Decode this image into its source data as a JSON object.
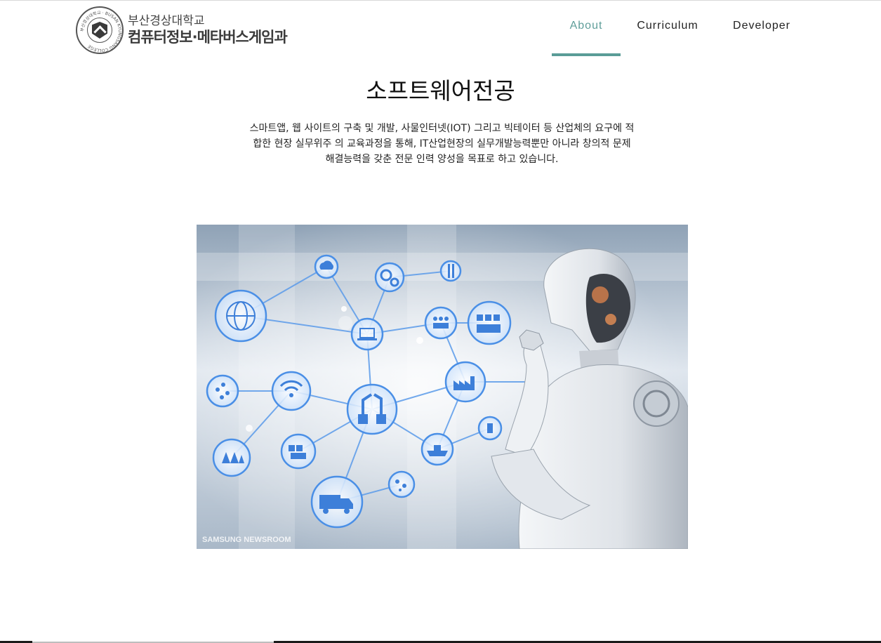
{
  "header": {
    "logo": {
      "university": "부산경상대학교",
      "department": "컴퓨터정보·메타버스게임과",
      "seal_text": "부산경상대학교 · BUSAN KYUNGSANG COLLEGE"
    },
    "nav": [
      {
        "label": "About",
        "active": true
      },
      {
        "label": "Curriculum",
        "active": false
      },
      {
        "label": "Developer",
        "active": false
      }
    ],
    "accent_color": "#5a9c97"
  },
  "main": {
    "title": "소프트웨어전공",
    "description_lines": [
      "스마트앱, 웹 사이트의 구축 및 개발, 사물인터넷(IOT) 그리고 빅테이터 등 산업체의 요구에 적",
      "합한 현장 실무위주 의 교육과정을 통해, IT산업현장의 실무개발능력뿐만 아니라 창의적 문제",
      "해결능력을 갖춘 전문 인력 양성을 목표로 하고 있습니다."
    ],
    "hero_image": {
      "subject": "humanoid robot thinking beside a network of technology icons",
      "watermark": "SAMSUNG NEWSROOM",
      "icons": [
        "cloud-icon",
        "gears-icon",
        "tools-icon",
        "globe-icon",
        "laptop-icon",
        "people-icon",
        "team-icon",
        "drops-icon",
        "wifi-icon",
        "robot-arms-icon",
        "factory-icon",
        "antenna-icon",
        "boxes-icon",
        "ship-icon",
        "truck-icon",
        "map-pins-icon"
      ]
    }
  }
}
